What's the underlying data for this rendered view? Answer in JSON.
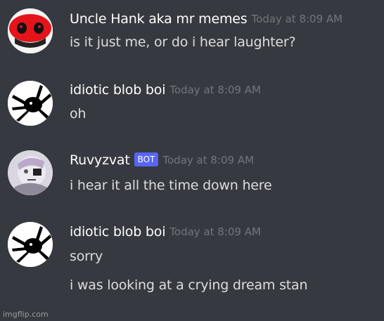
{
  "messages": [
    {
      "username": "Uncle Hank aka mr memes",
      "timestamp": "Today at 8:09 AM",
      "avatar_icon": "red-mask-avatar",
      "lines": [
        "is it just me, or do i hear laughter?"
      ]
    },
    {
      "username": "idiotic blob boi",
      "timestamp": "Today at 8:09 AM",
      "avatar_icon": "black-spider-avatar",
      "lines": [
        "oh"
      ]
    },
    {
      "username": "Ruvyzvat",
      "bot_tag": "BOT",
      "timestamp": "Today at 8:09 AM",
      "avatar_icon": "character-sketch-avatar",
      "lines": [
        "i hear it all the time down here"
      ]
    },
    {
      "username": "idiotic blob boi",
      "timestamp": "Today at 8:09 AM",
      "avatar_icon": "black-spider-avatar",
      "lines": [
        "sorry",
        "i was looking at a crying dream stan"
      ]
    }
  ],
  "watermark": "imgflip.com",
  "colors": {
    "background": "#36393f",
    "username": "#ffffff",
    "message_text": "#dcddde",
    "timestamp": "#72767d",
    "bot_tag": "#5865f2"
  }
}
